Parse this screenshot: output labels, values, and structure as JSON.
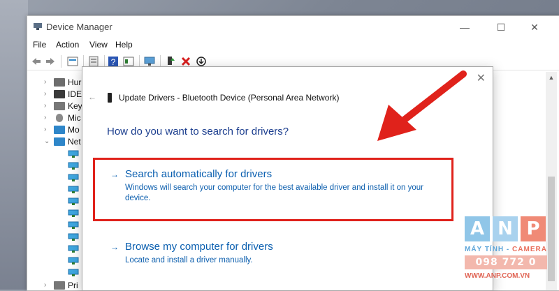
{
  "window": {
    "title": "Device Manager",
    "controls": [
      "—",
      "☐",
      "✕"
    ]
  },
  "menu": [
    "File",
    "Action",
    "View",
    "Help"
  ],
  "toolbar_icons": [
    "back-arrow-icon",
    "forward-arrow-icon",
    "properties-icon",
    "scan-hardware-icon",
    "help-icon",
    "details-icon",
    "monitor-icon",
    "update-driver-icon",
    "uninstall-icon",
    "disable-icon"
  ],
  "tree": [
    {
      "label": "Hur",
      "icon": "hid-icon",
      "color": "#6d6d6d"
    },
    {
      "label": "IDE",
      "icon": "ide-icon",
      "color": "#3a3a3a"
    },
    {
      "label": "Key",
      "icon": "keyboard-icon",
      "color": "#777777"
    },
    {
      "label": "Mic",
      "icon": "mouse-icon",
      "color": "#8a8a8a"
    },
    {
      "label": "Mo",
      "icon": "monitor-icon",
      "color": "#2e86c9"
    },
    {
      "label": "Net",
      "icon": "network-icon",
      "color": "#2e86c9"
    },
    {
      "label": "Pri",
      "icon": "printer-icon",
      "color": "#777777"
    }
  ],
  "dialog": {
    "header": "Update Drivers - Bluetooth Device (Personal Area Network)",
    "question": "How do you want to search for drivers?",
    "option1": {
      "title": "Search automatically for drivers",
      "desc": "Windows will search your computer for the best available driver and install it on your device."
    },
    "option2": {
      "title": "Browse my computer for drivers",
      "desc": "Locate and install a driver manually."
    },
    "close": "✕",
    "back": "←",
    "arrow": "→"
  },
  "watermark": {
    "letters": [
      "A",
      "N",
      "P"
    ],
    "tagline_left": "MÁY TÍNH",
    "tagline_sep": " - ",
    "tagline_right": "CAMERA",
    "phone": "098 772 0 772",
    "website": "WWW.ANP.COM.VN"
  },
  "colors": {
    "highlight": "#e0221b",
    "link": "#0a5fb0",
    "question": "#1d3f8f"
  }
}
